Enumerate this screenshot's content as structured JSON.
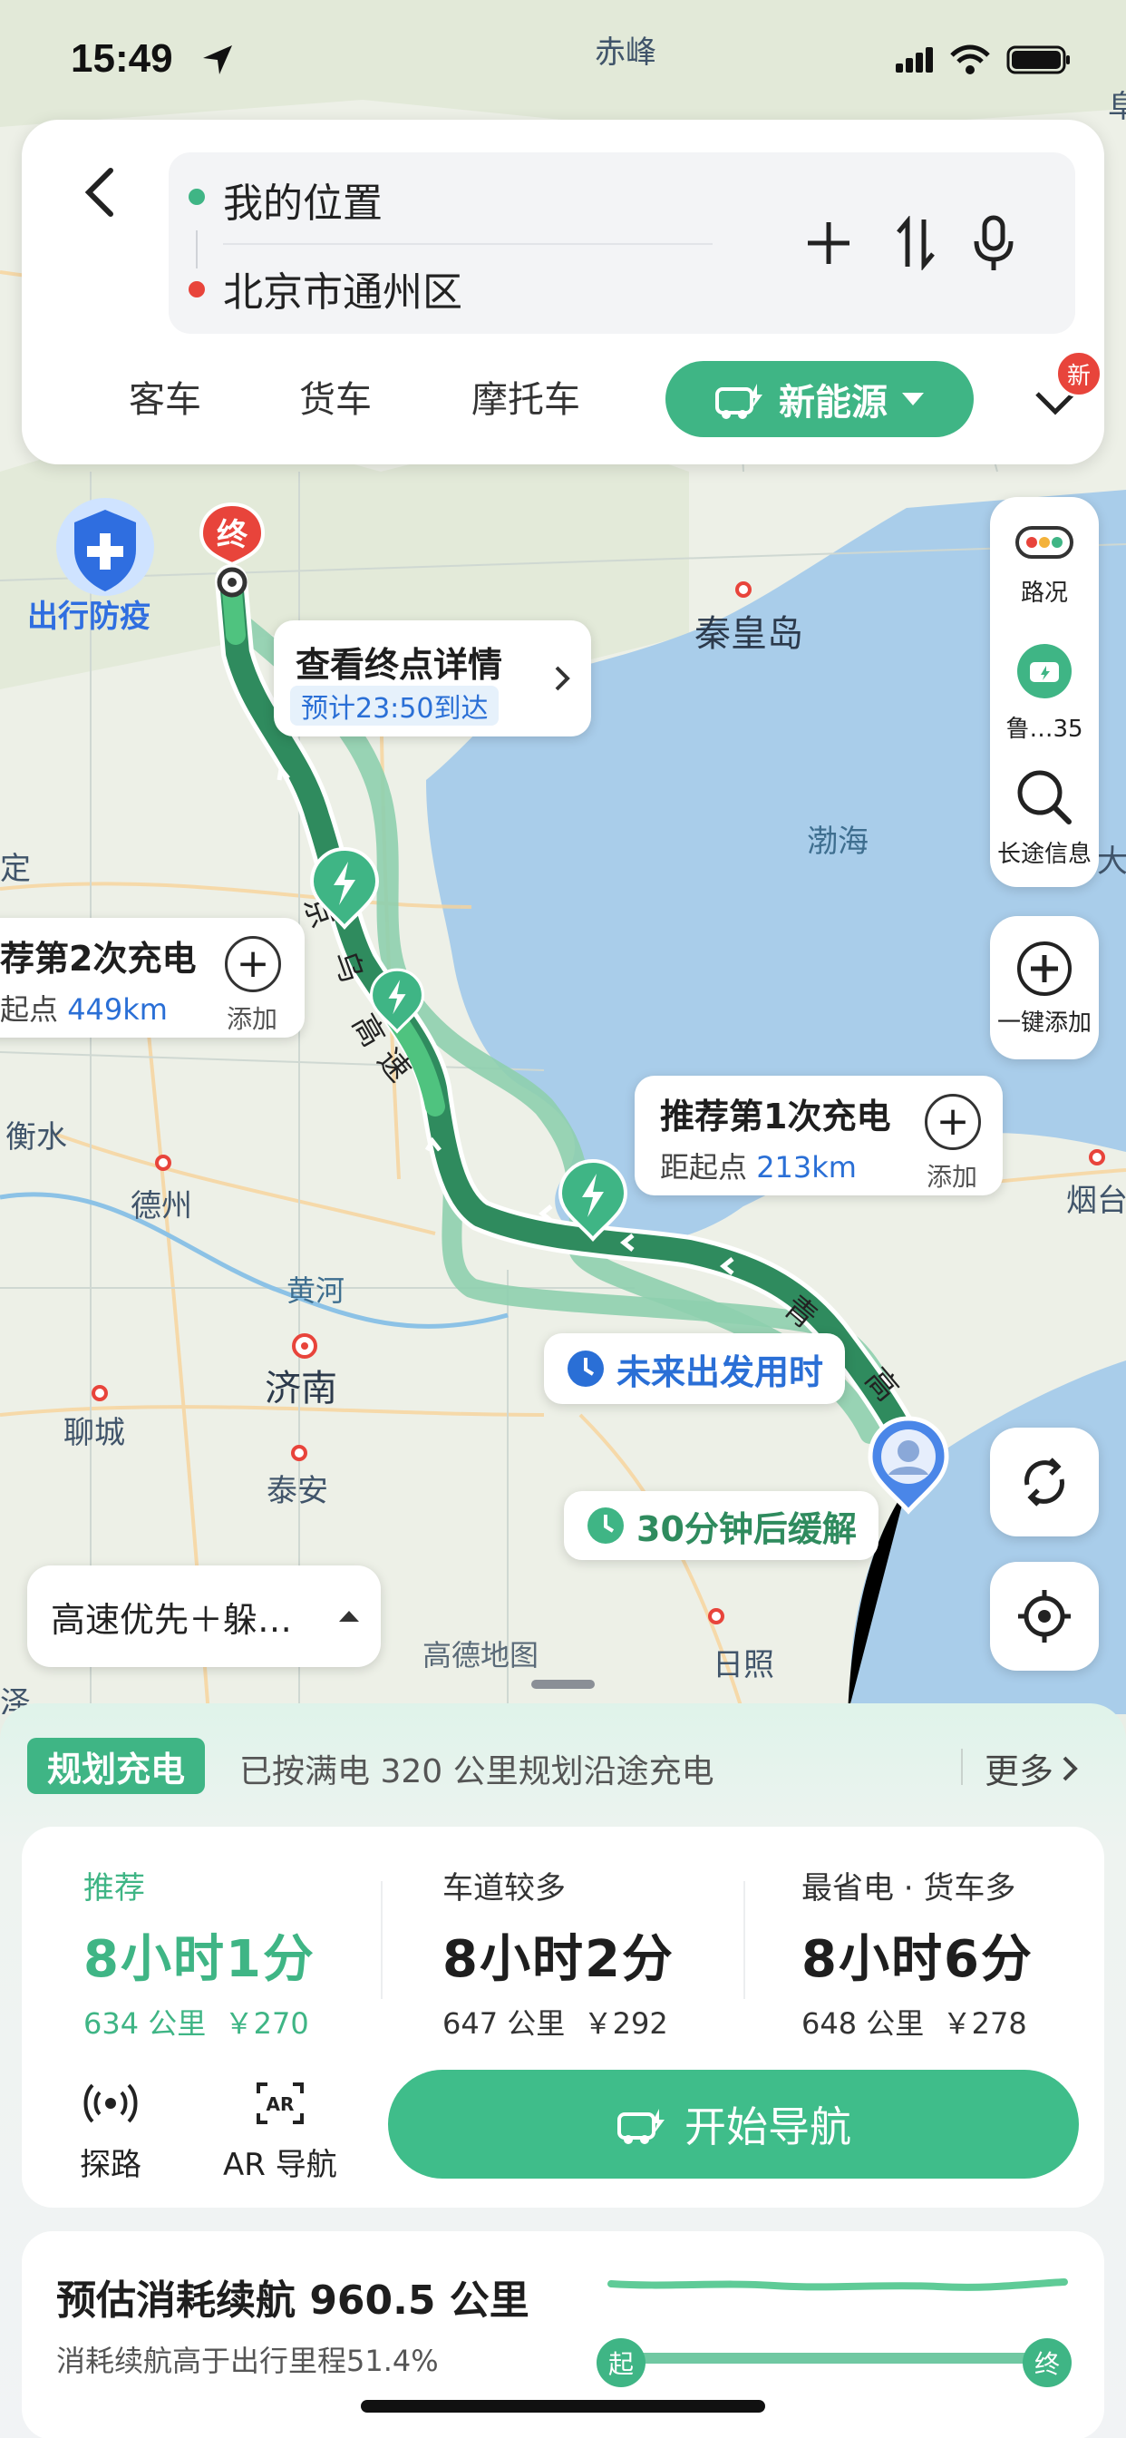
{
  "status_bar": {
    "time": "15:49"
  },
  "search": {
    "origin": "我的位置",
    "destination": "北京市通州区"
  },
  "vehicle_modes": {
    "items": [
      "客车",
      "货车",
      "摩托车"
    ],
    "active": "新能源",
    "new_badge": "新"
  },
  "map": {
    "labels": {
      "chifeng": "赤峰",
      "qinhuangdao": "秦皇岛",
      "bohai": "渤海",
      "dezhou": "德州",
      "hengshui": "衡水",
      "huanghe": "黄河",
      "jinan": "济南",
      "liaocheng": "聊城",
      "taian": "泰安",
      "rizhao": "日照",
      "yantai": "烟台",
      "edge_ding": "定",
      "edge_da": "大",
      "edge_ze": "泽",
      "edge_n": "阜",
      "brand": "高德地图",
      "road_1": "京",
      "road_2": "乌",
      "road_3": "高",
      "road_4": "速",
      "road_5": "青",
      "road_6": "高"
    },
    "epidemic_badge": "出行防疫",
    "end_marker": "终",
    "dest_detail": {
      "title": "查看终点详情",
      "eta": "预计23:50到达"
    },
    "charge2": {
      "title": "荐第2次充电",
      "dist_prefix": "起点",
      "dist": "449km",
      "add": "添加"
    },
    "charge1": {
      "title": "推荐第1次充电",
      "dist_prefix": "距起点",
      "dist": "213km",
      "add": "添加"
    },
    "future_departure": "未来出发用时",
    "congestion": "30分钟后缓解",
    "route_pref": "高速优先＋躲…"
  },
  "right_rail": {
    "traffic": "路况",
    "vehicle": "鲁…35",
    "long_trip": "长途信息",
    "quick_add": "一键添加"
  },
  "plan_bar": {
    "tag": "规划充电",
    "text": "已按满电 320 公里规划沿途充电",
    "more": "更多"
  },
  "routes": [
    {
      "label": "推荐",
      "duration": "8小时1分",
      "distance": "634 公里",
      "cost": "￥270"
    },
    {
      "label": "车道较多",
      "duration": "8小时2分",
      "distance": "647 公里",
      "cost": "￥292"
    },
    {
      "label": "最省电 · 货车多",
      "duration": "8小时6分",
      "distance": "648 公里",
      "cost": "￥278"
    }
  ],
  "actions": {
    "explore": "探路",
    "ar": "AR 导航",
    "start": "开始导航"
  },
  "energy": {
    "title": "预估消耗续航 960.5 公里",
    "subtitle": "消耗续航高于出行里程51.4%",
    "start_label": "起",
    "end_label": "终"
  },
  "colors": {
    "accent": "#3fb585",
    "route_dark": "#2f8b5e",
    "route_alt": "#8ecfae",
    "sea": "#a9cdea",
    "destination_red": "#e8443b",
    "blue_text": "#2a6fd6"
  }
}
